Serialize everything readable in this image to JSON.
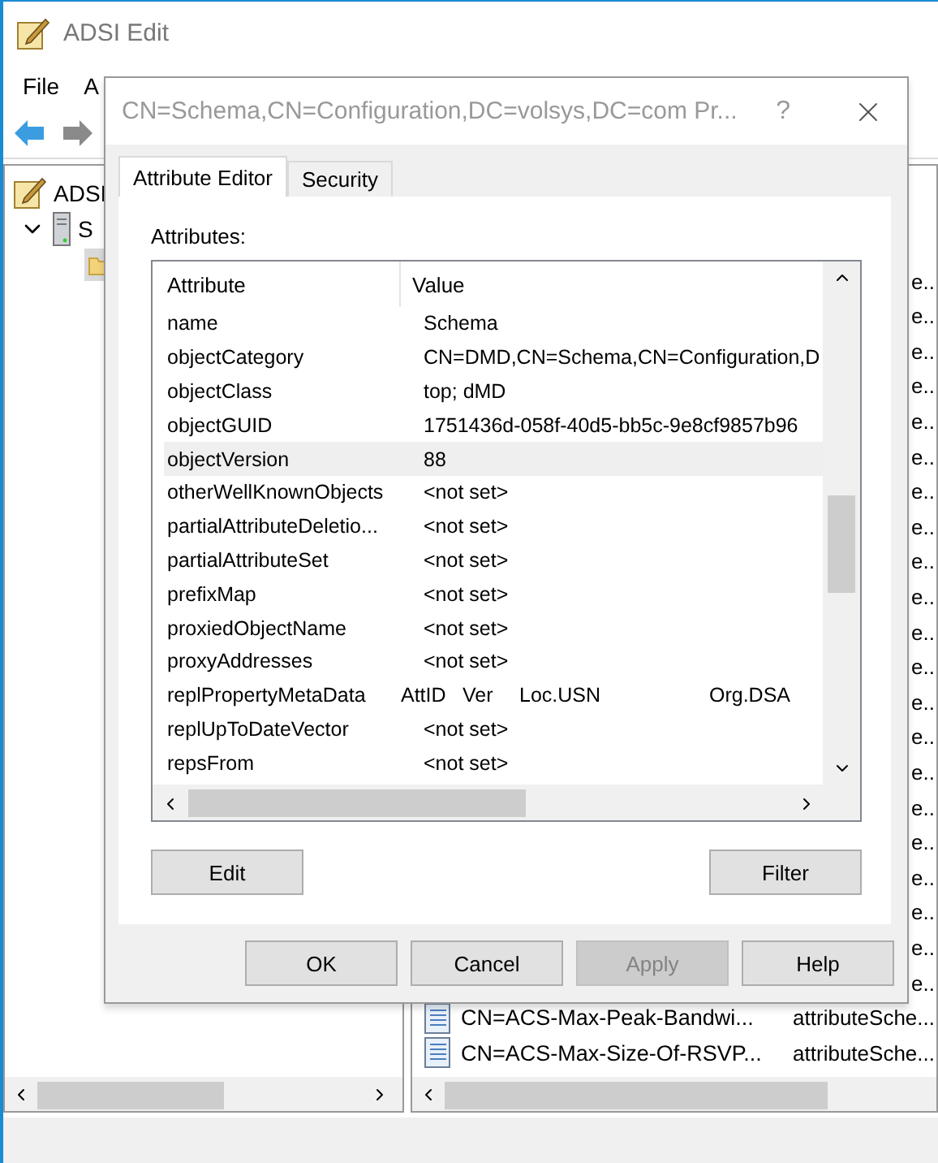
{
  "window": {
    "title": "ADSI Edit"
  },
  "menu": [
    "File",
    "A"
  ],
  "tree": [
    {
      "label": "ADSI",
      "children": [
        {
          "label": "S",
          "expanded": true,
          "children": [
            {
              "kind": "folder",
              "selected": true
            }
          ]
        }
      ]
    }
  ],
  "list_rows": [
    {
      "type": "e.."
    },
    {
      "type": "e.."
    },
    {
      "type": "e.."
    },
    {
      "type": "e.."
    },
    {
      "type": "e.."
    },
    {
      "type": "e.."
    },
    {
      "type": "e.."
    },
    {
      "type": "e.."
    },
    {
      "type": "e.."
    },
    {
      "type": "e.."
    },
    {
      "type": "e.."
    },
    {
      "type": "e.."
    },
    {
      "type": "e.."
    },
    {
      "type": "e.."
    },
    {
      "type": "e.."
    },
    {
      "type": "e.."
    },
    {
      "type": "e.."
    },
    {
      "type": "e.."
    },
    {
      "type": "e.."
    },
    {
      "type": "e.."
    },
    {
      "type": "e.."
    },
    {
      "name": "CN=ACS-Max-Peak-Bandwi...",
      "type": "attributeSche..."
    },
    {
      "name": "CN=ACS-Max-Size-Of-RSVP...",
      "type": "attributeSche..."
    }
  ],
  "dialog": {
    "title": "CN=Schema,CN=Configuration,DC=volsys,DC=com Pr...",
    "help": "?",
    "tabs": [
      {
        "label": "Attribute Editor",
        "selected": true
      },
      {
        "label": "Security",
        "selected": false
      }
    ],
    "attributes_label": "Attributes:",
    "columns": [
      "Attribute",
      "Value"
    ],
    "rows": [
      {
        "attribute": "name",
        "kind": "text",
        "value": "Schema",
        "selected": false
      },
      {
        "attribute": "objectCategory",
        "kind": "text",
        "value": "CN=DMD,CN=Schema,CN=Configuration,D",
        "selected": false
      },
      {
        "attribute": "objectClass",
        "kind": "text",
        "value": "top; dMD",
        "selected": false
      },
      {
        "attribute": "objectGUID",
        "kind": "text",
        "value": "1751436d-058f-40d5-bb5c-9e8cf9857b96",
        "selected": false
      },
      {
        "attribute": "objectVersion",
        "kind": "text",
        "value": "88",
        "selected": true
      },
      {
        "attribute": "otherWellKnownObjects",
        "kind": "text",
        "value": "<not set>",
        "selected": false
      },
      {
        "attribute": "partialAttributeDeletio...",
        "kind": "text",
        "value": "<not set>",
        "selected": false
      },
      {
        "attribute": "partialAttributeSet",
        "kind": "text",
        "value": "<not set>",
        "selected": false
      },
      {
        "attribute": "prefixMap",
        "kind": "text",
        "value": "<not set>",
        "selected": false
      },
      {
        "attribute": "proxiedObjectName",
        "kind": "text",
        "value": "<not set>",
        "selected": false
      },
      {
        "attribute": "proxyAddresses",
        "kind": "text",
        "value": "<not set>",
        "selected": false
      },
      {
        "attribute": "replPropertyMetaData",
        "kind": "columns",
        "value_columns": [
          "AttID",
          "Ver",
          "Loc.USN",
          "Org.DSA"
        ],
        "selected": false
      },
      {
        "attribute": "replUpToDateVector",
        "kind": "text",
        "value": "<not set>",
        "selected": false
      },
      {
        "attribute": "repsFrom",
        "kind": "text",
        "value": "<not set>",
        "selected": false
      }
    ],
    "edit_button": "Edit",
    "filter_button": "Filter",
    "buttons": [
      {
        "label": "OK",
        "disabled": false
      },
      {
        "label": "Cancel",
        "disabled": false
      },
      {
        "label": "Apply",
        "disabled": true
      },
      {
        "label": "Help",
        "disabled": false
      }
    ]
  }
}
